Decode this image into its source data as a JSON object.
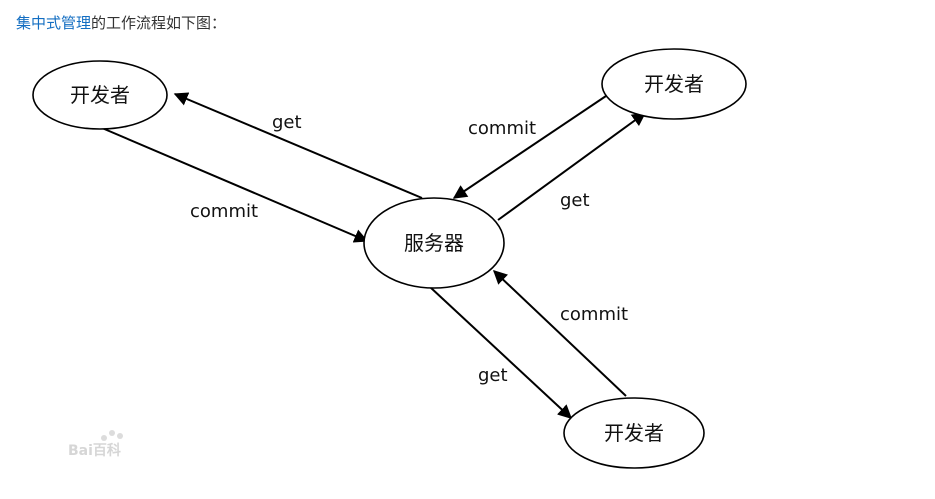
{
  "caption": {
    "link_text": "集中式管理",
    "rest_text": "的工作流程如下图："
  },
  "nodes": [
    {
      "id": "dev-top-left",
      "label": "开发者"
    },
    {
      "id": "dev-top-right",
      "label": "开发者"
    },
    {
      "id": "server",
      "label": "服务器"
    },
    {
      "id": "dev-bottom",
      "label": "开发者"
    }
  ],
  "edges": [
    {
      "id": "server-to-tl",
      "label": "get"
    },
    {
      "id": "tl-to-server",
      "label": "commit"
    },
    {
      "id": "tr-to-server",
      "label": "commit"
    },
    {
      "id": "server-to-tr",
      "label": "get"
    },
    {
      "id": "bottom-to-server",
      "label": "commit"
    },
    {
      "id": "server-to-bottom",
      "label": "get"
    }
  ],
  "watermark": {
    "text": "Bai百科"
  }
}
